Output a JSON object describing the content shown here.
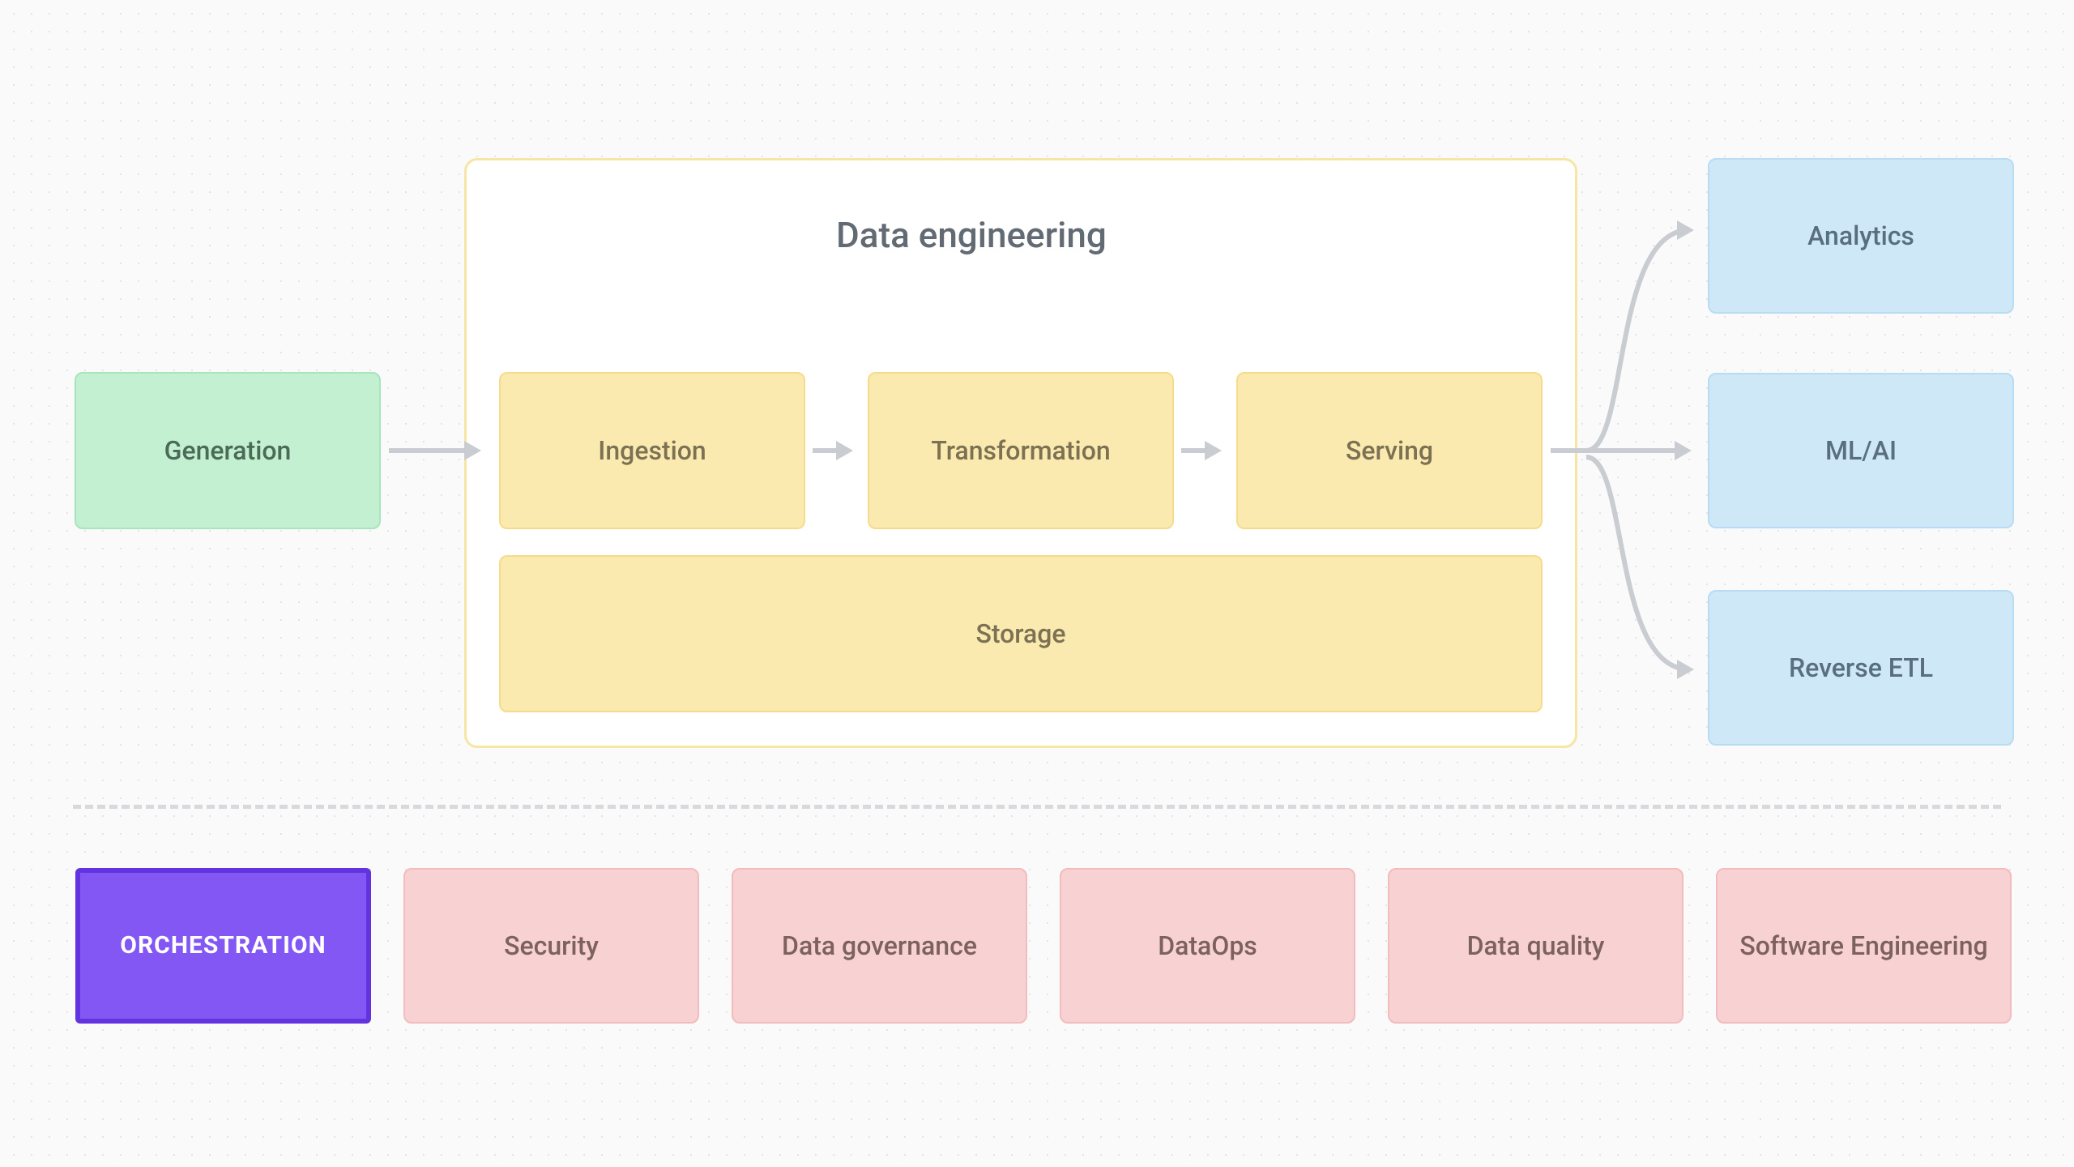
{
  "source": {
    "generation": "Generation"
  },
  "engineering": {
    "title": "Data engineering",
    "ingestion": "Ingestion",
    "transformation": "Transformation",
    "serving": "Serving",
    "storage": "Storage"
  },
  "outputs": {
    "analytics": "Analytics",
    "mlai": "ML/AI",
    "reverse_etl": "Reverse ETL"
  },
  "undercurrents": {
    "orchestration": "ORCHESTRATION",
    "security": "Security",
    "governance": "Data governance",
    "dataops": "DataOps",
    "quality": "Data quality",
    "swe": "Software Engineering"
  }
}
